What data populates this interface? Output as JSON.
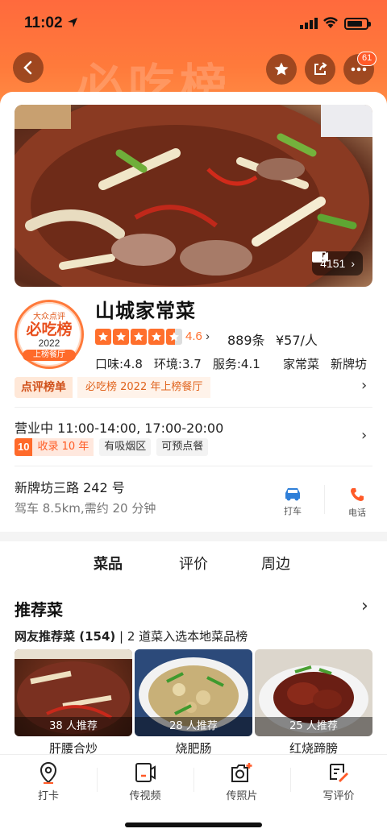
{
  "status_bar": {
    "time": "11:02"
  },
  "header": {
    "watermark": "必吃榜",
    "notification_count": "61"
  },
  "hero": {
    "media_count": "4151"
  },
  "shop": {
    "logo": {
      "brand": "大众点评",
      "title": "必吃榜",
      "year": "2022",
      "label": "上榜餐厅"
    },
    "name": "山城家常菜",
    "rating": "4.6",
    "rating_stars": 4.5,
    "reviews": "889条",
    "price": "¥57/人",
    "scores": [
      "口味:4.8",
      "环境:3.7",
      "服务:4.1"
    ],
    "categories": [
      "家常菜",
      "新牌坊"
    ],
    "rank": {
      "tag": "点评榜单",
      "text": "必吃榜 2022 年上榜餐厅"
    },
    "hours": "营业中 11:00-14:00, 17:00-20:00",
    "tags": {
      "years_num": "10",
      "years_text": "收录 10 年",
      "smoking": "有吸烟区",
      "booking": "可预点餐"
    },
    "address": "新牌坊三路 242 号",
    "drive": "驾车 8.5km,需约 20 分钟",
    "actions": {
      "taxi": "打车",
      "call": "电话"
    }
  },
  "tabs": [
    "菜品",
    "评价",
    "周边"
  ],
  "dishes": {
    "title": "推荐菜",
    "sub_bold": "网友推荐菜 (154)",
    "sub_rest": " | 2 道菜入选本地菜品榜",
    "items": [
      {
        "name": "肝腰合炒",
        "recommend": "38 人推荐"
      },
      {
        "name": "烧肥肠",
        "recommend": "28 人推荐"
      },
      {
        "name": "红烧蹄膀",
        "recommend": "25 人推荐"
      }
    ]
  },
  "bottom_bar": [
    "打卡",
    "传视频",
    "传照片",
    "写评价"
  ],
  "colors": {
    "accent": "#ff6f2c",
    "header": "#ff6a3d"
  }
}
